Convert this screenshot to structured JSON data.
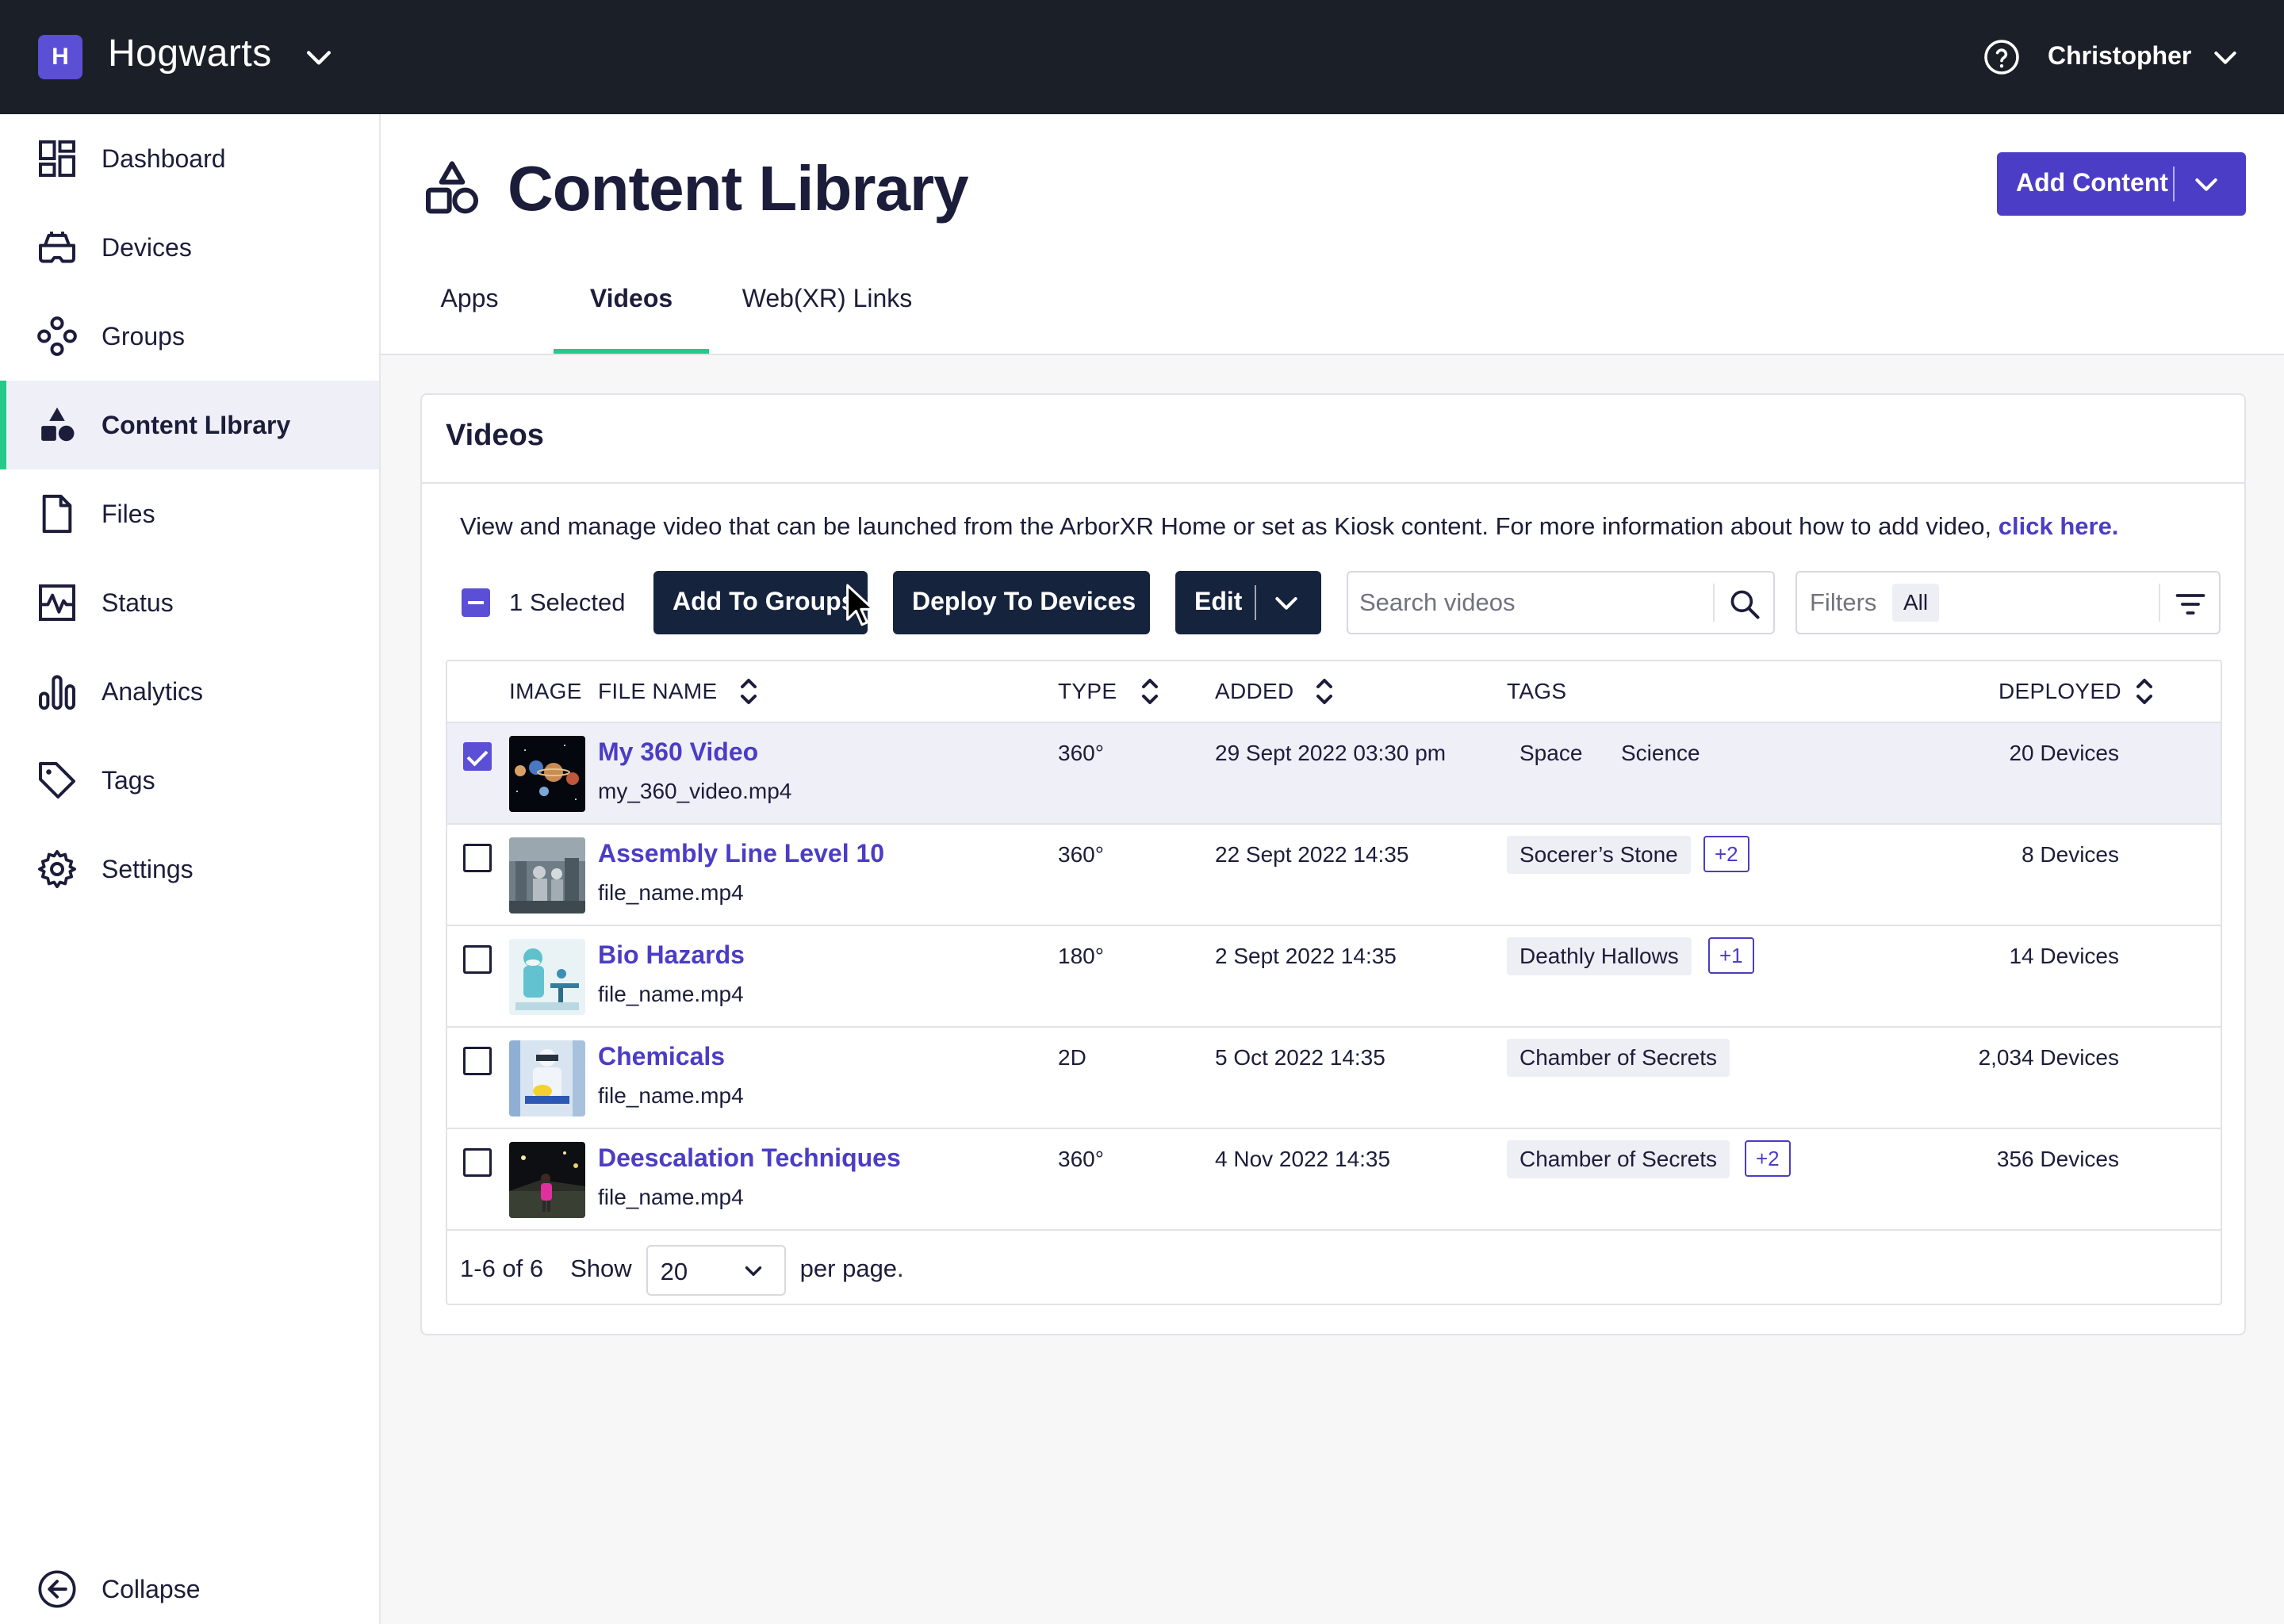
{
  "topbar": {
    "org_initial": "H",
    "org_name": "Hogwarts",
    "user_name": "Christopher"
  },
  "sidebar": {
    "items": [
      {
        "label": "Dashboard",
        "icon": "dashboard-icon"
      },
      {
        "label": "Devices",
        "icon": "headset-icon"
      },
      {
        "label": "Groups",
        "icon": "groups-icon"
      },
      {
        "label": "Content LIbrary",
        "icon": "content-library-icon",
        "active": true
      },
      {
        "label": "Files",
        "icon": "file-icon"
      },
      {
        "label": "Status",
        "icon": "status-pulse-icon"
      },
      {
        "label": "Analytics",
        "icon": "bar-chart-icon"
      },
      {
        "label": "Tags",
        "icon": "tag-icon"
      },
      {
        "label": "Settings",
        "icon": "gear-icon"
      }
    ],
    "collapse_label": "Collapse"
  },
  "header": {
    "title": "Content Library",
    "add_content_label": "Add Content",
    "tabs": [
      {
        "label": "Apps"
      },
      {
        "label": "Videos",
        "active": true
      },
      {
        "label": "Web(XR) Links"
      }
    ]
  },
  "card": {
    "title": "Videos",
    "description": "View and manage video that can be launched from the ArborXR Home or set as Kiosk content. For more information about how to add video,",
    "description_link": "click here."
  },
  "toolbar": {
    "selected_label": "1 Selected",
    "add_to_groups_label": "Add To Groups",
    "deploy_label": "Deploy To Devices",
    "edit_label": "Edit",
    "search_placeholder": "Search videos",
    "filters_label": "Filters",
    "filters_value": "All"
  },
  "table": {
    "columns": {
      "image": "IMAGE",
      "file_name": "FILE NAME",
      "type": "TYPE",
      "added": "ADDED",
      "tags": "TAGS",
      "deployed": "DEPLOYED"
    },
    "rows": [
      {
        "name": "My 360 Video",
        "file": "my_360_video.mp4",
        "type": "360°",
        "added": "29 Sept 2022 03:30 pm",
        "tag1": "Space",
        "tag2": "Science",
        "more": "",
        "deployed": "20 Devices",
        "checked": true
      },
      {
        "name": "Assembly Line Level 10",
        "file": "file_name.mp4",
        "type": "360°",
        "added": "22 Sept 2022 14:35",
        "tag1": "Socerer’s Stone",
        "tag2": "",
        "more": "+2",
        "deployed": "8 Devices",
        "checked": false
      },
      {
        "name": "Bio Hazards",
        "file": "file_name.mp4",
        "type": "180°",
        "added": "2 Sept 2022 14:35",
        "tag1": "Deathly Hallows",
        "tag2": "",
        "more": "+1",
        "deployed": "14 Devices",
        "checked": false
      },
      {
        "name": "Chemicals",
        "file": "file_name.mp4",
        "type": "2D",
        "added": "5 Oct 2022 14:35",
        "tag1": "Chamber of Secrets",
        "tag2": "",
        "more": "",
        "deployed": "2,034 Devices",
        "checked": false
      },
      {
        "name": "Deescalation Techniques",
        "file": "file_name.mp4",
        "type": "360°",
        "added": "4 Nov 2022 14:35",
        "tag1": "Chamber of Secrets",
        "tag2": "",
        "more": "+2",
        "deployed": "356 Devices",
        "checked": false
      }
    ]
  },
  "pager": {
    "range": "1-6 of 6",
    "show_label": "Show",
    "per_page_value": "20",
    "per_page_label": "per page."
  },
  "colors": {
    "accent": "#4b3dc5",
    "checkbox": "#5b4fd6",
    "active_tab": "#25c98a",
    "topbar": "#1b1f27",
    "dark_button": "#16233d"
  }
}
